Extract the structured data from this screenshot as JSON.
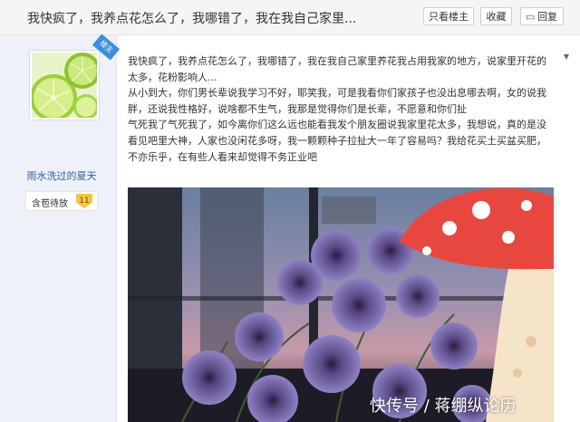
{
  "thread": {
    "title": "我快疯了，我养点花怎么了，我哪错了，我在我自己家里...",
    "only_op_label": "只看楼主",
    "favorite_label": "收藏",
    "reply_label": "回复",
    "reply_icon": "reply-icon"
  },
  "author": {
    "op_badge": "楼主",
    "name": "雨水洗过的夏天",
    "rank_title": "含苞待放",
    "level": "11",
    "avatar": "lime-slices-image"
  },
  "post": {
    "paragraphs": [
      "我快疯了，我养点花怎么了，我哪错了，我在我自己家里养花我占用我家的地方，说家里开花的太多，花粉影响人...",
      "从小到大，你们男长辈说我学习不好，耶笑我，可是我看你们家孩子也没出息哪去啊，女的说我胖，还说我性格好，说啥都不生气，我那是觉得你们是长辈，不愿意和你们扯",
      "气死我了气死我了，如今离你们这么远也能看我发个朋友圈说我家里花太多，我想说，真的是没看见吧里大神，人家也没闲花多呀，我一颗颗种子拉扯大一年了容易吗？我给花买土买盆买肥，不亦乐乎，在有些人看来却觉得不务正业吧"
    ],
    "image": "purple-petunias-with-mushroom-sticker"
  },
  "watermark": "快传号 / 蒋绷纵论历",
  "colors": {
    "link_blue": "#2a5fa8",
    "badge_blue": "#3c8de0",
    "sidebar_bg": "#eef2f8",
    "mushroom_red": "#e8473f"
  }
}
